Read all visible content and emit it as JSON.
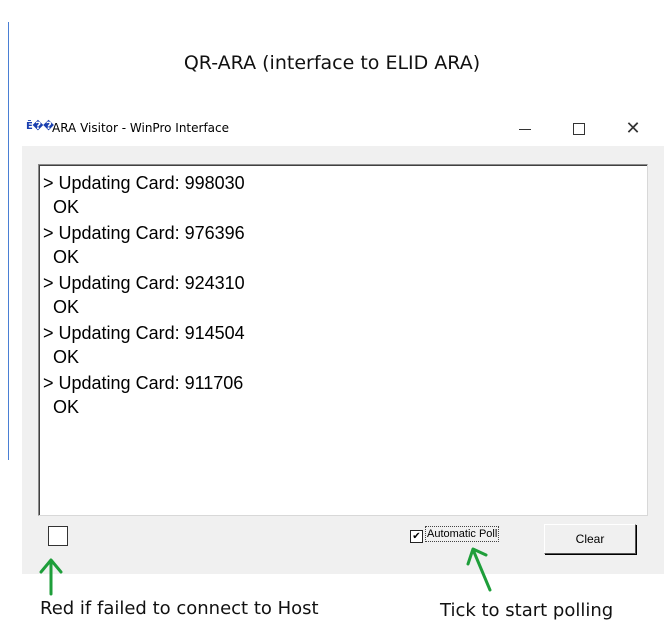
{
  "heading": "QR-ARA (interface to ELID ARA)",
  "window": {
    "icon_text": "Ē��",
    "title": "ARA Visitor - WinPro Interface",
    "minimize_glyph": "",
    "close_glyph": "✕"
  },
  "log": {
    "lines": [
      "> Updating Card: 998030",
      "  OK",
      "> Updating Card: 976396",
      "  OK",
      "> Updating Card: 924310",
      "  OK",
      "> Updating Card: 914504",
      "  OK",
      "> Updating Card: 911706",
      "  OK"
    ]
  },
  "controls": {
    "automatic_poll_label": "Automatic Poll",
    "automatic_poll_checked": true,
    "checkbox_mark": "✔",
    "clear_label": "Clear",
    "connection_status": "ok"
  },
  "annotations": {
    "left_caption": "Red if failed to connect to Host",
    "right_caption": "Tick to start polling",
    "arrow_color": "#1e9e3a"
  },
  "icons": [
    "app-icon",
    "minimize-icon",
    "maximize-icon",
    "close-icon",
    "arrow-up-icon"
  ]
}
